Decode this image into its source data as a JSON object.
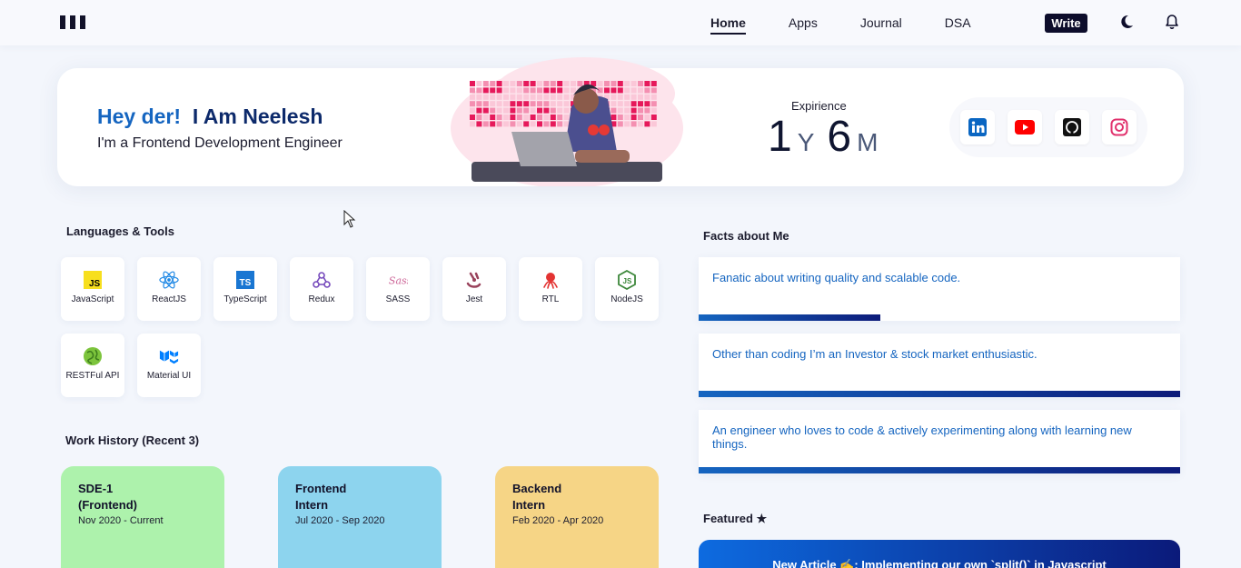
{
  "nav": {
    "items": [
      "Home",
      "Apps",
      "Journal",
      "DSA"
    ],
    "active": "Home",
    "write_label": "Write"
  },
  "hero": {
    "greeting": "Hey der!",
    "name": "I Am Neelesh",
    "role": "I'm a Frontend Development Engineer",
    "experience_label": "Expirience",
    "years": "1",
    "years_unit": "Y",
    "months": "6",
    "months_unit": "M",
    "socials": [
      "linkedin-icon",
      "youtube-icon",
      "github-icon",
      "instagram-icon"
    ]
  },
  "tools": {
    "title": "Languages & Tools",
    "items": [
      "JavaScript",
      "ReactJS",
      "TypeScript",
      "Redux",
      "SASS",
      "Jest",
      "RTL",
      "NodeJS",
      "RESTFul API",
      "Material UI"
    ]
  },
  "work": {
    "title": "Work History (Recent 3)",
    "jobs": [
      {
        "title_line1": "SDE-1",
        "title_line2": "(Frontend)",
        "dates": "Nov 2020 - Current",
        "color": "#adf2ac"
      },
      {
        "title_line1": "Frontend",
        "title_line2": "Intern",
        "dates": "Jul 2020 - Sep 2020",
        "color": "#8dd4ee"
      },
      {
        "title_line1": "Backend",
        "title_line2": "Intern",
        "dates": "Feb 2020 - Apr 2020",
        "color": "#f6d586"
      }
    ]
  },
  "facts": {
    "title": "Facts about Me",
    "items": [
      {
        "text": "Fanatic about writing quality and scalable code.",
        "progress": 0.377
      },
      {
        "text": "Other than coding I’m an Investor & stock market enthusiastic.",
        "progress": 1.0
      },
      {
        "text": "An engineer who loves to code & actively experimenting along with learning new things.",
        "progress": 1.0
      }
    ]
  },
  "featured": {
    "title": "Featured ★",
    "article": "New Article ✍️: Implementing our own `split()` in Javascript"
  },
  "colors": {
    "brand_blue": "#1565c0",
    "navy": "#0d0d2b"
  }
}
